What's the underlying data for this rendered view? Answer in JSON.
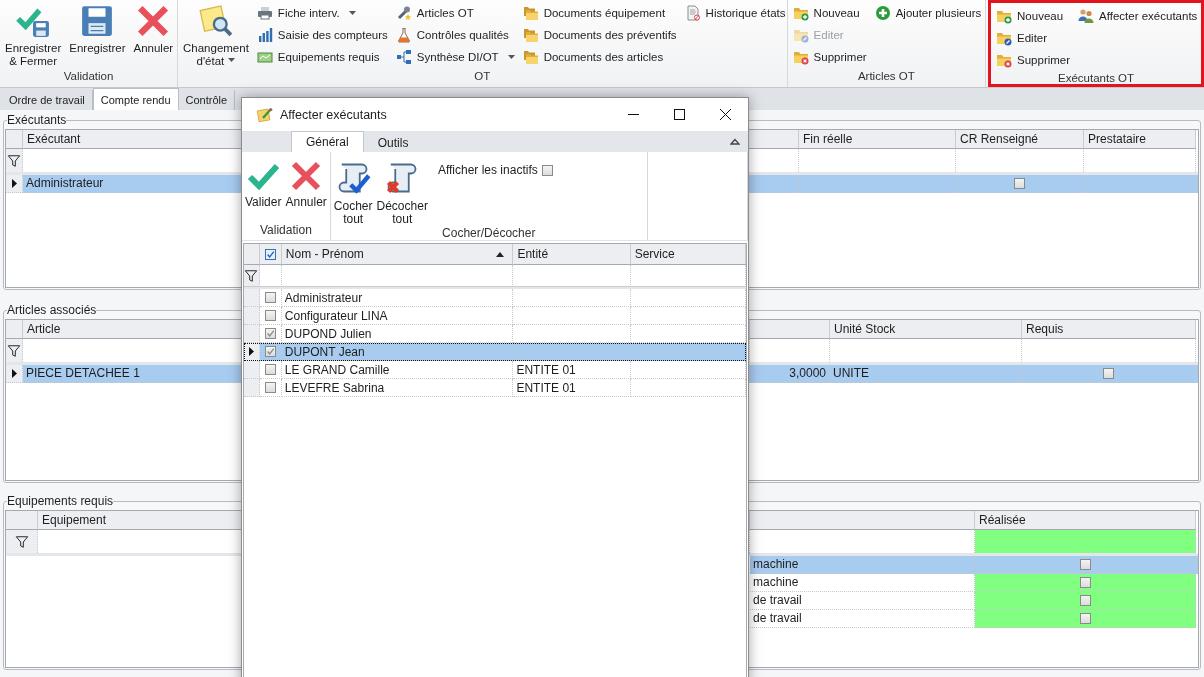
{
  "ribbon": {
    "groups": [
      {
        "label": "Validation",
        "highlighted": false,
        "large": [
          {
            "label": "Enregistrer\n& Fermer",
            "dropdown": false
          },
          {
            "label": "Enregistrer",
            "dropdown": false
          },
          {
            "label": "Annuler",
            "dropdown": false
          }
        ]
      },
      {
        "label": "OT",
        "highlighted": false,
        "large": [
          {
            "label": "Changement\nd'état",
            "dropdown": true
          }
        ],
        "columns": [
          [
            {
              "label": "Fiche interv.",
              "dropdown": true,
              "disabled": false
            },
            {
              "label": "Saisie des compteurs",
              "dropdown": false,
              "disabled": false
            },
            {
              "label": "Equipements requis",
              "dropdown": false,
              "disabled": false
            }
          ],
          [
            {
              "label": "Articles OT",
              "dropdown": false,
              "disabled": false
            },
            {
              "label": "Contrôles qualités",
              "dropdown": false,
              "disabled": false
            },
            {
              "label": "Synthèse DI/OT",
              "dropdown": true,
              "disabled": false
            }
          ],
          [
            {
              "label": "Documents équipement",
              "dropdown": false,
              "disabled": false
            },
            {
              "label": "Documents des préventifs",
              "dropdown": false,
              "disabled": false
            },
            {
              "label": "Documents des articles",
              "dropdown": false,
              "disabled": false
            }
          ],
          [
            {
              "label": "Historique états",
              "dropdown": false,
              "disabled": false
            }
          ]
        ]
      },
      {
        "label": "Articles OT",
        "highlighted": false,
        "columns": [
          [
            {
              "label": "Nouveau",
              "dropdown": false,
              "disabled": false
            },
            {
              "label": "Editer",
              "dropdown": false,
              "disabled": true
            },
            {
              "label": "Supprimer",
              "dropdown": false,
              "disabled": false
            }
          ],
          [
            {
              "label": "Ajouter plusieurs",
              "dropdown": false,
              "disabled": false
            }
          ]
        ]
      },
      {
        "label": "Exécutants OT",
        "highlighted": true,
        "columns": [
          [
            {
              "label": "Nouveau",
              "dropdown": false,
              "disabled": false
            },
            {
              "label": "Editer",
              "dropdown": false,
              "disabled": false
            },
            {
              "label": "Supprimer",
              "dropdown": false,
              "disabled": false
            }
          ],
          [
            {
              "label": "Affecter exécutants",
              "dropdown": false,
              "disabled": false
            }
          ]
        ]
      }
    ]
  },
  "tabs": [
    {
      "label": "Ordre de travail",
      "selected": false
    },
    {
      "label": "Compte rendu",
      "selected": true
    },
    {
      "label": "Contrôle",
      "selected": false
    }
  ],
  "sections": [
    {
      "title": "Exécutants",
      "columns": [
        {
          "label": "Exécutant"
        },
        {
          "label": "Fin réelle"
        },
        {
          "label": "CR Renseigné"
        },
        {
          "label": "Prestataire"
        }
      ],
      "rows": [
        {
          "selected": true,
          "cells": [
            {
              "text": "Administrateur"
            },
            {
              "kind": "blank"
            },
            {
              "kind": "checkbox",
              "checked": false
            },
            {
              "kind": "blank"
            }
          ]
        }
      ]
    },
    {
      "title": "Articles associés",
      "columns": [
        {
          "label": "Article"
        },
        {
          "kind": "unlabeled"
        },
        {
          "label": "Unité Stock"
        },
        {
          "label": "Requis"
        }
      ],
      "rows": [
        {
          "selected": true,
          "cells": [
            {
              "text": "PIECE DETACHEE 1"
            },
            {
              "text": "3,0000"
            },
            {
              "text": "UNITE"
            },
            {
              "kind": "checkbox",
              "checked": false
            }
          ]
        }
      ]
    },
    {
      "title": "Equipements requis",
      "columns": [
        {
          "label": "Equipement"
        },
        {
          "kind": "unlabeled"
        },
        {
          "label": "Réalisée",
          "color": "#80ff80"
        }
      ],
      "rows": [
        {
          "selected": true,
          "cells": [
            {
              "kind": "void"
            },
            {
              "text": "machine"
            },
            {
              "kind": "checkbox",
              "checked": false
            }
          ]
        },
        {
          "selected": false,
          "cells": [
            {
              "kind": "void"
            },
            {
              "text": "machine"
            },
            {
              "kind": "checkbox",
              "checked": false
            }
          ]
        },
        {
          "selected": false,
          "cells": [
            {
              "kind": "void"
            },
            {
              "text": "de travail"
            },
            {
              "kind": "checkbox",
              "checked": false
            }
          ]
        },
        {
          "selected": false,
          "cells": [
            {
              "kind": "void"
            },
            {
              "text": "de travail"
            },
            {
              "kind": "checkbox",
              "checked": false
            }
          ]
        }
      ]
    }
  ],
  "dialog": {
    "title": "Affecter exécutants",
    "tabs": [
      {
        "label": "Général",
        "selected": true
      },
      {
        "label": "Outils",
        "selected": false
      }
    ],
    "groups": [
      {
        "label": "Validation",
        "buttons": [
          {
            "label": "Valider"
          },
          {
            "label": "Annuler"
          }
        ]
      },
      {
        "label": "Cocher/Décocher",
        "buttons": [
          {
            "label": "Cocher\ntout"
          },
          {
            "label": "Décocher\ntout"
          }
        ],
        "option": {
          "label": "Afficher les inactifs",
          "checked": false
        }
      }
    ],
    "grid": {
      "all_checked": true,
      "columns": [
        {
          "label": "Nom - Prénom",
          "sorted": true
        },
        {
          "label": "Entité",
          "sorted": false
        },
        {
          "label": "Service",
          "sorted": false
        }
      ],
      "rows": [
        {
          "checked": false,
          "selected": false,
          "name": "Administrateur"
        },
        {
          "checked": false,
          "selected": false,
          "name": "Configurateur LINA"
        },
        {
          "checked": true,
          "selected": false,
          "name": "DUPOND Julien"
        },
        {
          "checked": true,
          "selected": true,
          "name": "DUPONT Jean"
        },
        {
          "checked": false,
          "selected": false,
          "name": "LE GRAND Camille",
          "entite": "ENTITE 01"
        },
        {
          "checked": false,
          "selected": false,
          "name": "LEVEFRE Sabrina",
          "entite": "ENTITE 01"
        }
      ]
    }
  }
}
